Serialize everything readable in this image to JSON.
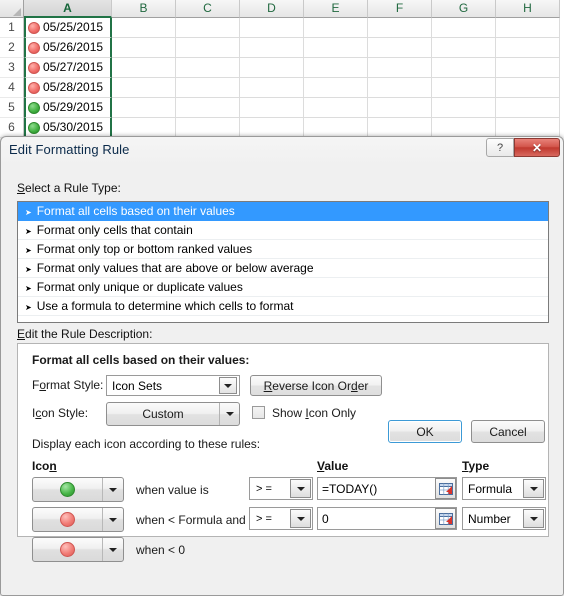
{
  "spreadsheet": {
    "column_headers": [
      "A",
      "B",
      "C",
      "D",
      "E",
      "F",
      "G",
      "H"
    ],
    "selected_column": "A",
    "row_numbers": [
      "1",
      "2",
      "3",
      "4",
      "5",
      "6"
    ],
    "rows": [
      {
        "num": "1",
        "icon": "red",
        "value": "05/25/2015"
      },
      {
        "num": "2",
        "icon": "red",
        "value": "05/26/2015"
      },
      {
        "num": "3",
        "icon": "red",
        "value": "05/27/2015"
      },
      {
        "num": "4",
        "icon": "red",
        "value": "05/28/2015"
      },
      {
        "num": "5",
        "icon": "green",
        "value": "05/29/2015"
      },
      {
        "num": "6",
        "icon": "green",
        "value": "05/30/2015"
      }
    ]
  },
  "dialog": {
    "title": "Edit Formatting Rule",
    "help_button": "?",
    "close_button": "✕",
    "rule_type_label": "Select a Rule Type:",
    "rule_types": [
      {
        "label": "Format all cells based on their values",
        "selected": true
      },
      {
        "label": "Format only cells that contain",
        "selected": false
      },
      {
        "label": "Format only top or bottom ranked values",
        "selected": false
      },
      {
        "label": "Format only values that are above or below average",
        "selected": false
      },
      {
        "label": "Format only unique or duplicate values",
        "selected": false
      },
      {
        "label": "Use a formula to determine which cells to format",
        "selected": false
      }
    ],
    "rule_description_label": "Edit the Rule Description:",
    "description_heading": "Format all cells based on their values:",
    "format_style_label": "Format Style:",
    "format_style_value": "Icon Sets",
    "reverse_icon_order_label": "Reverse Icon Order",
    "icon_style_label": "Icon Style:",
    "icon_style_value": "Custom",
    "show_icon_only_label": "Show Icon Only",
    "show_icon_only_checked": false,
    "display_rules_label": "Display each icon according to these rules:",
    "columns": {
      "icon": "Icon",
      "value": "Value",
      "type": "Type"
    },
    "icon_rules": [
      {
        "icon_color": "green",
        "when_text": "when value is",
        "operator": ">=",
        "value": "=TODAY()",
        "type": "Formula",
        "has_value_field": true
      },
      {
        "icon_color": "red",
        "when_text": "when < Formula and",
        "operator": ">=",
        "value": "0",
        "type": "Number",
        "has_value_field": true
      },
      {
        "icon_color": "red",
        "when_text": "when < 0",
        "operator": "",
        "value": "",
        "type": "",
        "has_value_field": false
      }
    ],
    "ok_label": "OK",
    "cancel_label": "Cancel"
  },
  "colors": {
    "accent_selected": "#3399ff",
    "excel_green": "#217346",
    "icon_green": "#3fae3f",
    "icon_red": "#ef6b66",
    "close_red": "#c0392f"
  }
}
